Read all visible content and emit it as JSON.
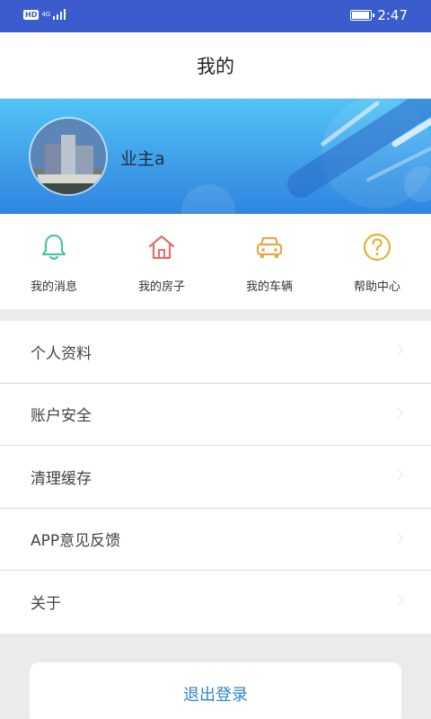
{
  "status_bar": {
    "hd_badge": "HD",
    "network": "4G",
    "time": "2:47",
    "battery_level": 0.85
  },
  "header": {
    "title": "我的"
  },
  "profile": {
    "username": "业主a"
  },
  "quick_actions": [
    {
      "label": "我的消息",
      "icon": "bell-icon",
      "color": "#4cc3a6"
    },
    {
      "label": "我的房子",
      "icon": "house-icon",
      "color": "#e0706a"
    },
    {
      "label": "我的车辆",
      "icon": "car-icon",
      "color": "#e8a64a"
    },
    {
      "label": "帮助中心",
      "icon": "help-icon",
      "color": "#e6b23a"
    }
  ],
  "menu": [
    {
      "label": "个人资料"
    },
    {
      "label": "账户安全"
    },
    {
      "label": "清理缓存"
    },
    {
      "label": "APP意见反馈"
    },
    {
      "label": "关于"
    }
  ],
  "logout": {
    "label": "退出登录"
  },
  "colors": {
    "status_bar": "#3b5ccc",
    "banner": "#3f9fe9",
    "accent": "#2f87c9"
  }
}
